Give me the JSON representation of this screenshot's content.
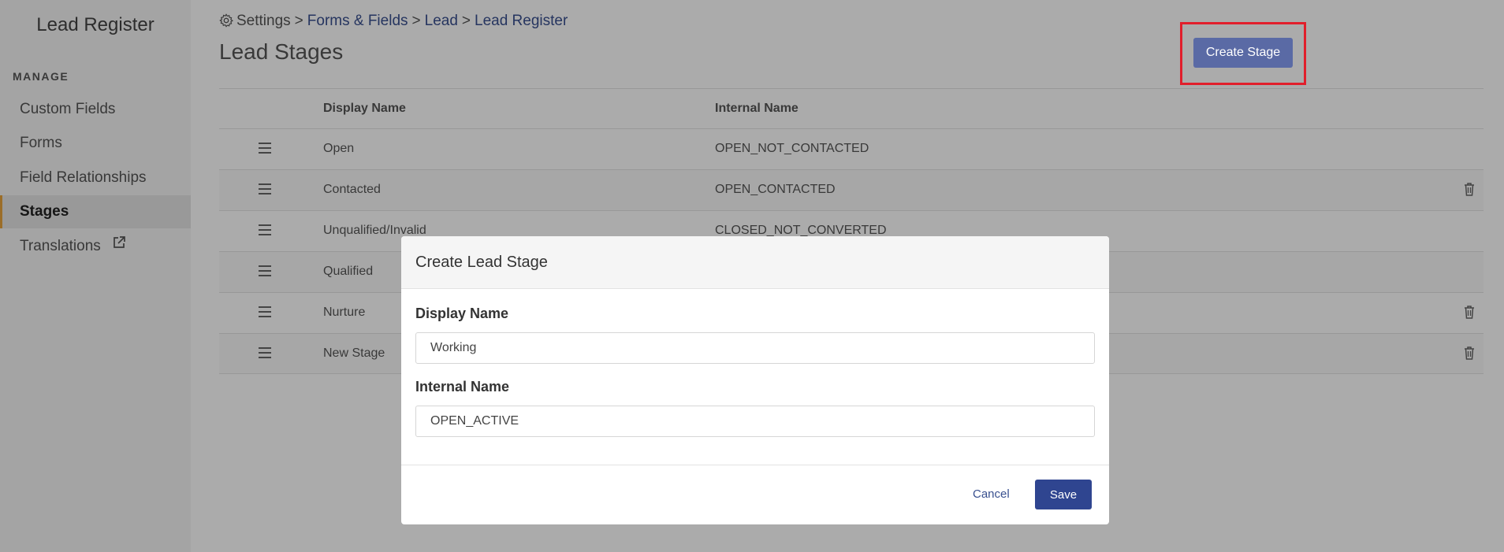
{
  "sidebar": {
    "title": "Lead Register",
    "section_label": "MANAGE",
    "items": [
      {
        "label": "Custom Fields"
      },
      {
        "label": "Forms"
      },
      {
        "label": "Field Relationships"
      },
      {
        "label": "Stages",
        "active": true
      },
      {
        "label": "Translations",
        "icon": "external-link-icon"
      }
    ]
  },
  "breadcrumb": {
    "icon": "gear-icon",
    "items": [
      "Settings",
      "Forms & Fields",
      "Lead",
      "Lead Register"
    ],
    "separator": ">"
  },
  "page": {
    "title": "Lead Stages",
    "create_button": "Create Stage"
  },
  "table": {
    "headers": {
      "display": "Display Name",
      "internal": "Internal Name"
    },
    "rows": [
      {
        "display": "Open",
        "internal": "OPEN_NOT_CONTACTED",
        "deletable": false
      },
      {
        "display": "Contacted",
        "internal": "OPEN_CONTACTED",
        "deletable": true
      },
      {
        "display": "Unqualified/Invalid",
        "internal": "CLOSED_NOT_CONVERTED",
        "deletable": false
      },
      {
        "display": "Qualified",
        "internal": "",
        "deletable": false
      },
      {
        "display": "Nurture",
        "internal": "",
        "deletable": true
      },
      {
        "display": "New Stage",
        "internal": "",
        "deletable": true
      }
    ]
  },
  "modal": {
    "title": "Create Lead Stage",
    "display_label": "Display Name",
    "display_value": "Working",
    "internal_label": "Internal Name",
    "internal_value": "OPEN_ACTIVE",
    "cancel_label": "Cancel",
    "save_label": "Save"
  },
  "colors": {
    "accent": "#2f4590",
    "link": "#39508f",
    "highlight": "#e11e2b",
    "active_marker": "#e8a33d"
  }
}
